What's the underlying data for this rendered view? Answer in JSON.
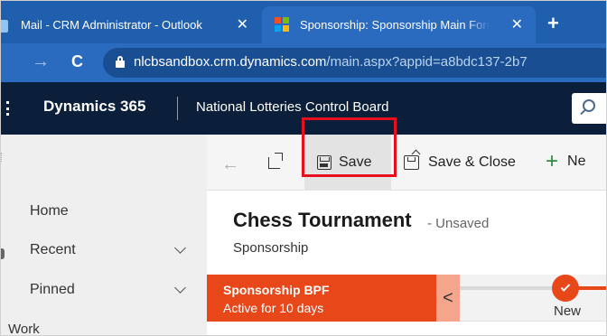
{
  "browser": {
    "tabs": [
      {
        "title": "Mail - CRM Administrator - Outlook",
        "close": "✕"
      },
      {
        "title": "Sponsorship: Sponsorship Main Form",
        "close": "✕"
      }
    ],
    "new_tab": "+",
    "forward": "→",
    "reload": "C",
    "url_host": "nlcbsandbox.crm.dynamics.com",
    "url_path": "/main.aspx?appid=a8bdc137-2b7"
  },
  "app": {
    "name": "Dynamics 365",
    "org": "National Lotteries Control Board"
  },
  "sidebar": {
    "items": [
      {
        "label": "Home"
      },
      {
        "label": "Recent"
      },
      {
        "label": "Pinned"
      },
      {
        "label": "Work"
      }
    ]
  },
  "toolbar": {
    "back": "←",
    "save_label": "Save",
    "save_close_label": "Save & Close",
    "new_label": "Ne"
  },
  "record": {
    "title": "Chess Tournament",
    "status": "- Unsaved",
    "entity": "Sponsorship"
  },
  "bpf": {
    "name": "Sponsorship BPF",
    "duration": "Active for 10 days",
    "collapse": "<",
    "stage": "New"
  },
  "colors": {
    "browser_tab_bar": "#1f5fae",
    "app_header": "#0b1f3a",
    "bpf_accent": "#e8471a",
    "highlight": "#e8101f"
  }
}
